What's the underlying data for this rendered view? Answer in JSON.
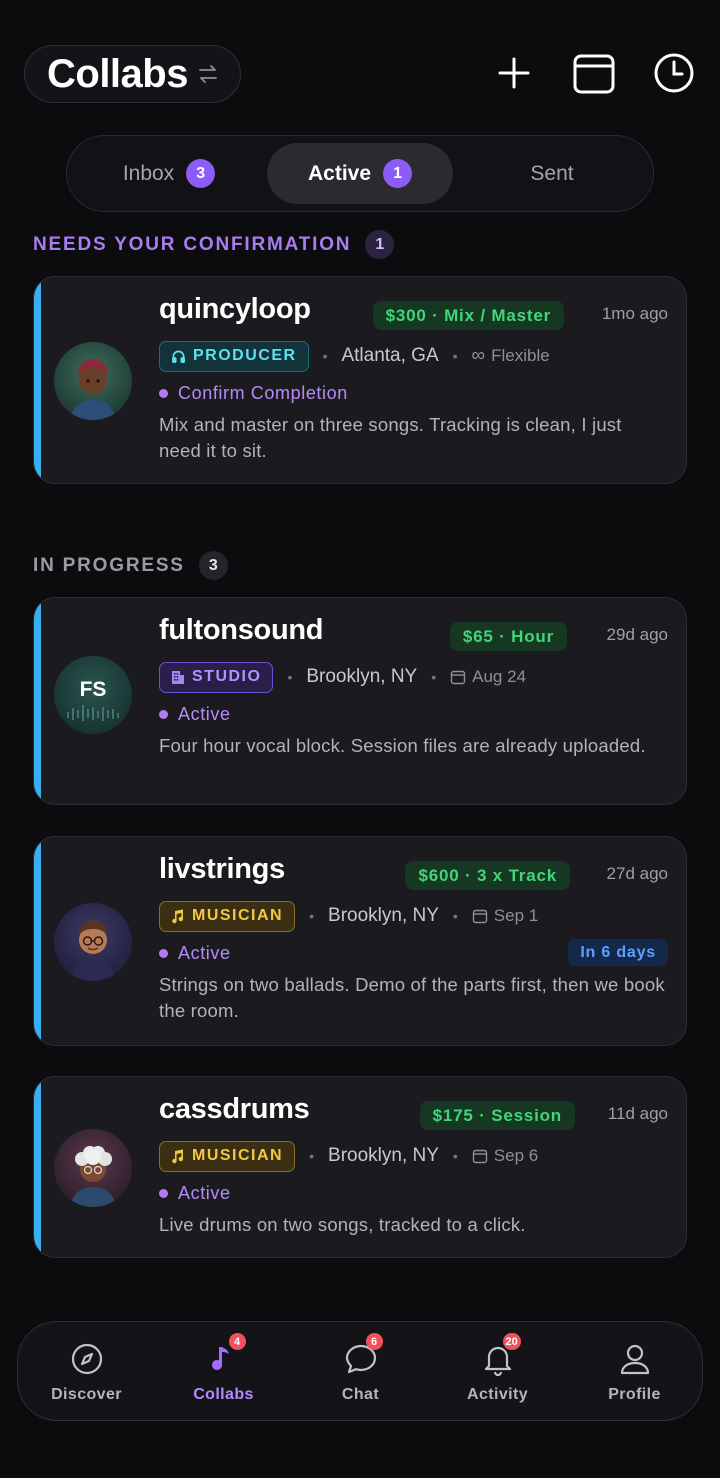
{
  "header": {
    "title": "Collabs"
  },
  "tabs": [
    {
      "label": "Inbox",
      "count": "3"
    },
    {
      "label": "Active",
      "count": "1"
    },
    {
      "label": "Sent"
    }
  ],
  "sections": {
    "confirm": {
      "label": "NEEDS YOUR CONFIRMATION",
      "count": "1"
    },
    "progress": {
      "label": "IN PROGRESS",
      "count": "3"
    }
  },
  "cards": [
    {
      "username": "quincyloop",
      "price": "$300 · Mix / Master",
      "ago": "1mo ago",
      "role": "PRODUCER",
      "location": "Atlanta, GA",
      "meta": "Flexible",
      "status": "Confirm Completion",
      "description": "Mix and master on three songs. Tracking is clean, I just need it to sit."
    },
    {
      "username": "fultonsound",
      "avatar_initials": "FS",
      "price": "$65 · Hour",
      "ago": "29d ago",
      "role": "STUDIO",
      "location": "Brooklyn, NY",
      "meta": "Aug 24",
      "status": "Active",
      "description": "Four hour vocal block. Session files are already uploaded."
    },
    {
      "username": "livstrings",
      "price": "$600 · 3 x Track",
      "ago": "27d ago",
      "role": "MUSICIAN",
      "location": "Brooklyn, NY",
      "meta": "Sep 1",
      "status": "Active",
      "due": "In 6 days",
      "description": "Strings on two ballads. Demo of the parts first, then we book the room."
    },
    {
      "username": "cassdrums",
      "price": "$175 · Session",
      "ago": "11d ago",
      "role": "MUSICIAN",
      "location": "Brooklyn, NY",
      "meta": "Sep 6",
      "status": "Active",
      "description": "Live drums on two songs, tracked to a click."
    }
  ],
  "nav": [
    {
      "label": "Discover",
      "icon": "compass-icon"
    },
    {
      "label": "Collabs",
      "icon": "music-note-icon",
      "badge": "4"
    },
    {
      "label": "Chat",
      "icon": "chat-bubble-icon",
      "badge": "6"
    },
    {
      "label": "Activity",
      "icon": "bell-icon",
      "badge": "20"
    },
    {
      "label": "Profile",
      "icon": "person-icon"
    }
  ],
  "colors": {
    "background": "#0c0c0f",
    "accent_purple": "#8b5cf6",
    "card_accent": "#3aaef0",
    "price_green": "#3fd777",
    "badge_red": "#f2505d"
  }
}
